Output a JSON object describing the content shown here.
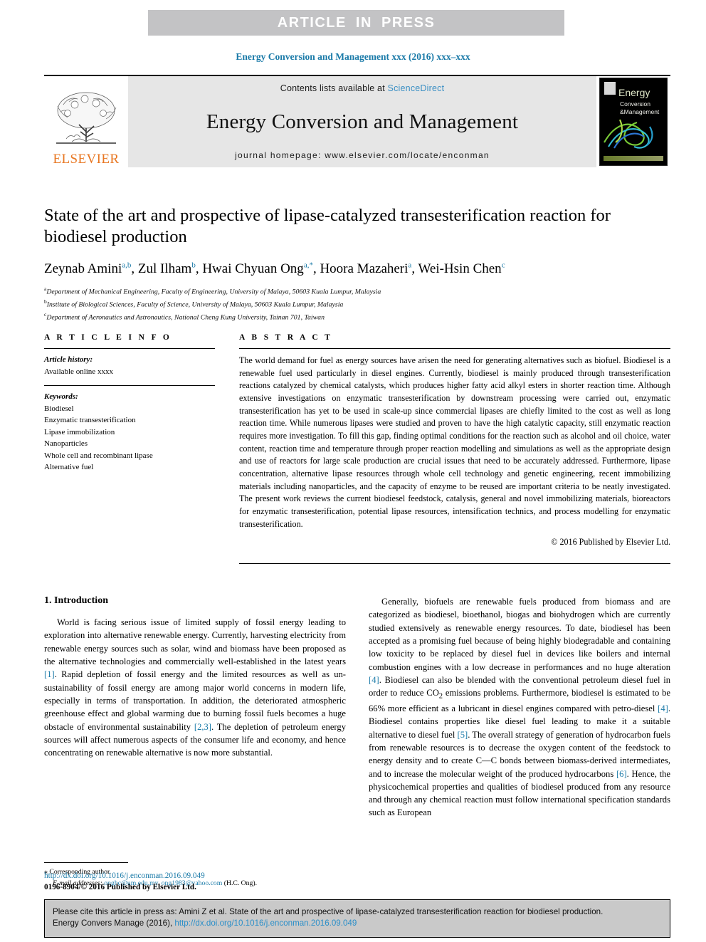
{
  "banner": {
    "press_label": "ARTICLE  IN  PRESS"
  },
  "citation_line": "Energy Conversion and Management xxx (2016) xxx–xxx",
  "masthead": {
    "publisher_name": "ELSEVIER",
    "contents_prefix": "Contents lists available at ",
    "contents_link": "ScienceDirect",
    "journal_title": "Energy Conversion and Management",
    "homepage": "journal homepage: www.elsevier.com/locate/enconman",
    "cover": {
      "title": "Energy",
      "subtitle_line1": "Conversion",
      "subtitle_line2": "&Management"
    }
  },
  "article": {
    "title": "State of the art and prospective of lipase-catalyzed transesterification reaction for biodiesel production",
    "authors": [
      {
        "name": "Zeynab Amini",
        "marks": "a,b",
        "sep": ", "
      },
      {
        "name": "Zul Ilham",
        "marks": "b",
        "sep": ", "
      },
      {
        "name": "Hwai Chyuan Ong",
        "marks": "a,*",
        "sep": ", "
      },
      {
        "name": "Hoora Mazaheri",
        "marks": "a",
        "sep": ", "
      },
      {
        "name": "Wei-Hsin Chen",
        "marks": "c",
        "sep": ""
      }
    ],
    "affiliations": [
      {
        "mark": "a",
        "text": "Department of Mechanical Engineering, Faculty of Engineering, University of Malaya, 50603 Kuala Lumpur, Malaysia"
      },
      {
        "mark": "b",
        "text": "Institute of Biological Sciences, Faculty of Science, University of Malaya, 50603 Kuala Lumpur, Malaysia"
      },
      {
        "mark": "c",
        "text": "Department of Aeronautics and Astronautics, National Cheng Kung University, Tainan 701, Taiwan"
      }
    ]
  },
  "article_info": {
    "heading": "A R T I C L E    I N F O",
    "history_label": "Article history:",
    "history_value": "Available online xxxx",
    "keywords_label": "Keywords:",
    "keywords": [
      "Biodiesel",
      "Enzymatic transesterification",
      "Lipase immobilization",
      "Nanoparticles",
      "Whole cell and recombinant lipase",
      "Alternative fuel"
    ]
  },
  "abstract": {
    "heading": "A B S T R A C T",
    "text": "The world demand for fuel as energy sources have arisen the need for generating alternatives such as biofuel. Biodiesel is a renewable fuel used particularly in diesel engines. Currently, biodiesel is mainly produced through transesterification reactions catalyzed by chemical catalysts, which produces higher fatty acid alkyl esters in shorter reaction time. Although extensive investigations on enzymatic transesterification by downstream processing were carried out, enzymatic transesterification has yet to be used in scale-up since commercial lipases are chiefly limited to the cost as well as long reaction time. While numerous lipases were studied and proven to have the high catalytic capacity, still enzymatic reaction requires more investigation. To fill this gap, finding optimal conditions for the reaction such as alcohol and oil choice, water content, reaction time and temperature through proper reaction modelling and simulations as well as the appropriate design and use of reactors for large scale production are crucial issues that need to be accurately addressed. Furthermore, lipase concentration, alternative lipase resources through whole cell technology and genetic engineering, recent immobilizing materials including nanoparticles, and the capacity of enzyme to be reused are important criteria to be neatly investigated. The present work reviews the current biodiesel feedstock, catalysis, general and novel immobilizing materials, bioreactors for enzymatic transesterification, potential lipase resources, intensification technics, and process modelling for enzymatic transesterification.",
    "copyright": "© 2016 Published by Elsevier Ltd."
  },
  "introduction": {
    "section_title": "1. Introduction",
    "left_paragraph_part1": "World is facing serious issue of limited supply of fossil energy leading to exploration into alternative renewable energy. Currently, harvesting electricity from renewable energy sources such as solar, wind and biomass have been proposed as the alternative technologies and commercially well-established in the latest years ",
    "left_ref1": "[1]",
    "left_paragraph_part2": ". Rapid depletion of fossil energy and the limited resources as well as un-sustainability of fossil energy are among major world concerns in modern life, especially in terms of transportation. In addition, the deteriorated atmospheric greenhouse effect and global warming due to burning fossil fuels becomes a huge obstacle of environmental sustainability ",
    "left_ref2": "[2,3]",
    "left_paragraph_part3": ". The depletion of petroleum energy sources will affect numerous aspects of the consumer life and economy, and hence concentrating on renewable alternative is now more substantial.",
    "right_paragraph_part1": "Generally, biofuels are renewable fuels produced from biomass and are categorized as biodiesel, bioethanol, biogas and biohydrogen which are currently studied extensively as renewable energy resources. To date, biodiesel has been accepted as a promising fuel because of being highly biodegradable and containing low toxicity to be replaced by diesel fuel in devices like boilers and internal combustion engines with a low decrease in performances and no huge alteration ",
    "right_ref1": "[4]",
    "right_paragraph_part2": ". Biodiesel can also be blended with the conventional petroleum diesel fuel in order to reduce CO",
    "right_co2_sub": "2",
    "right_paragraph_part3": " emissions problems. Furthermore, biodiesel is estimated to be 66% more efficient as a lubricant in diesel engines compared with petro-diesel ",
    "right_ref2": "[4]",
    "right_paragraph_part4": ". Biodiesel contains properties like diesel fuel leading to make it a suitable alternative to diesel fuel ",
    "right_ref3": "[5]",
    "right_paragraph_part5": ". The overall strategy of generation of hydrocarbon fuels from renewable resources is to decrease the oxygen content of the feedstock to energy density and to create C—C bonds between biomass-derived intermediates, and to increase the molecular weight of the produced hydrocarbons ",
    "right_ref4": "[6]",
    "right_paragraph_part6": ". Hence, the physicochemical properties and qualities of biodiesel produced from any resource and through any chemical reaction must follow international specification standards such as European"
  },
  "footnote": {
    "corresponding_star": "⁎",
    "corresponding_label": "Corresponding author.",
    "email_label": "E-mail addresses:",
    "email1": "onghc@um.edu.my",
    "email_sep": ", ",
    "email2": "ong1983@yahoo.com",
    "email_owner": " (H.C. Ong)."
  },
  "footer": {
    "doi": "http://dx.doi.org/10.1016/j.enconman.2016.09.049",
    "issn": "0196-8904/© 2016 Published by Elsevier Ltd."
  },
  "cite_box": {
    "line1": "Please cite this article in press as: Amini Z et al. State of the art and prospective of lipase-catalyzed transesterification reaction for biodiesel production.",
    "line2_prefix": "Energy Convers Manage (2016), ",
    "line2_doi": "http://dx.doi.org/10.1016/j.enconman.2016.09.049"
  },
  "colors": {
    "link_teal": "#1a7aa8",
    "sciencedirect_blue": "#3a8fc4",
    "elsevier_orange": "#e87722",
    "banner_gray": "#c3c3c5",
    "masthead_gray": "#e6e6e6",
    "cite_box_gray": "#c9c9c9"
  }
}
